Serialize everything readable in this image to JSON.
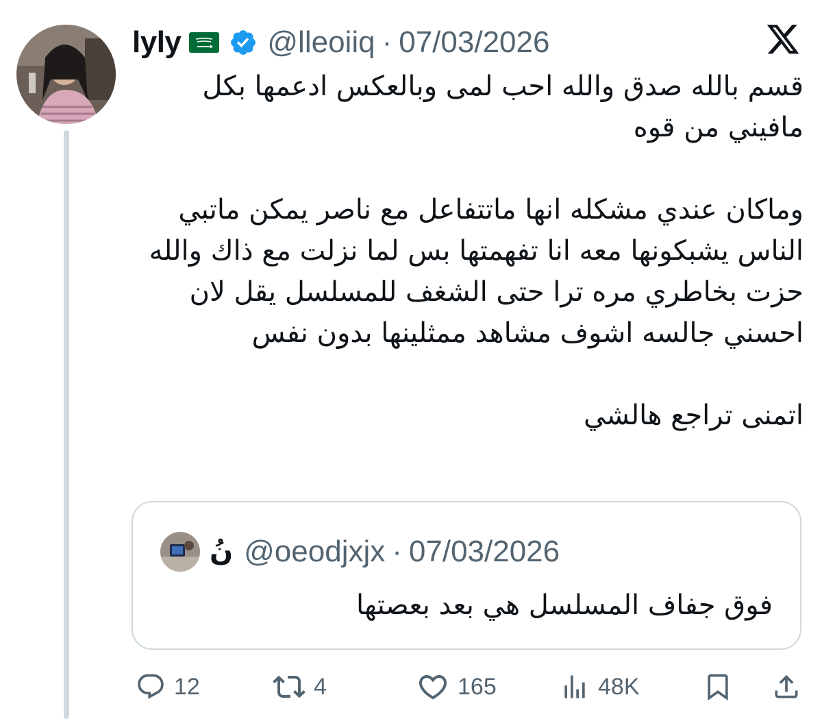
{
  "tweet": {
    "author_name": "lyly",
    "handle": "@lleoiiq",
    "separator": "·",
    "date": "07/03/2026",
    "paragraphs": [
      "قسم بالله صدق والله احب لمى وبالعكس ادعمها بكل مافيني من قوه",
      "وماكان عندي مشكله انها ماتتفاعل مع ناصر يمكن ماتبي الناس يشبكونها معه انا تفهمتها بس لما نزلت مع ذاك والله حزت بخاطري مره ترا حتى الشغف للمسلسل يقل لان احسني جالسه اشوف مشاهد ممثلينها بدون نفس",
      "اتمنى تراجع هالشي"
    ]
  },
  "quoted_tweet": {
    "author_name": "نُ",
    "handle": "@oeodjxjx",
    "separator": "·",
    "date": "07/03/2026",
    "text": "فوق جفاف المسلسل هي بعد بعصتها"
  },
  "actions": {
    "replies": "12",
    "reposts": "4",
    "likes": "165",
    "views": "48K"
  },
  "icons": {
    "brand": "x-logo-icon",
    "verified": "verified-badge-icon",
    "flag": "saudi-flag-icon",
    "reply": "reply-icon",
    "repost": "repost-icon",
    "like": "heart-icon",
    "views": "views-chart-icon",
    "bookmark": "bookmark-icon",
    "share": "share-icon"
  },
  "colors": {
    "text": "#0f1419",
    "secondary": "#536471",
    "verified": "#1d9bf0",
    "border": "#cfd9de"
  }
}
